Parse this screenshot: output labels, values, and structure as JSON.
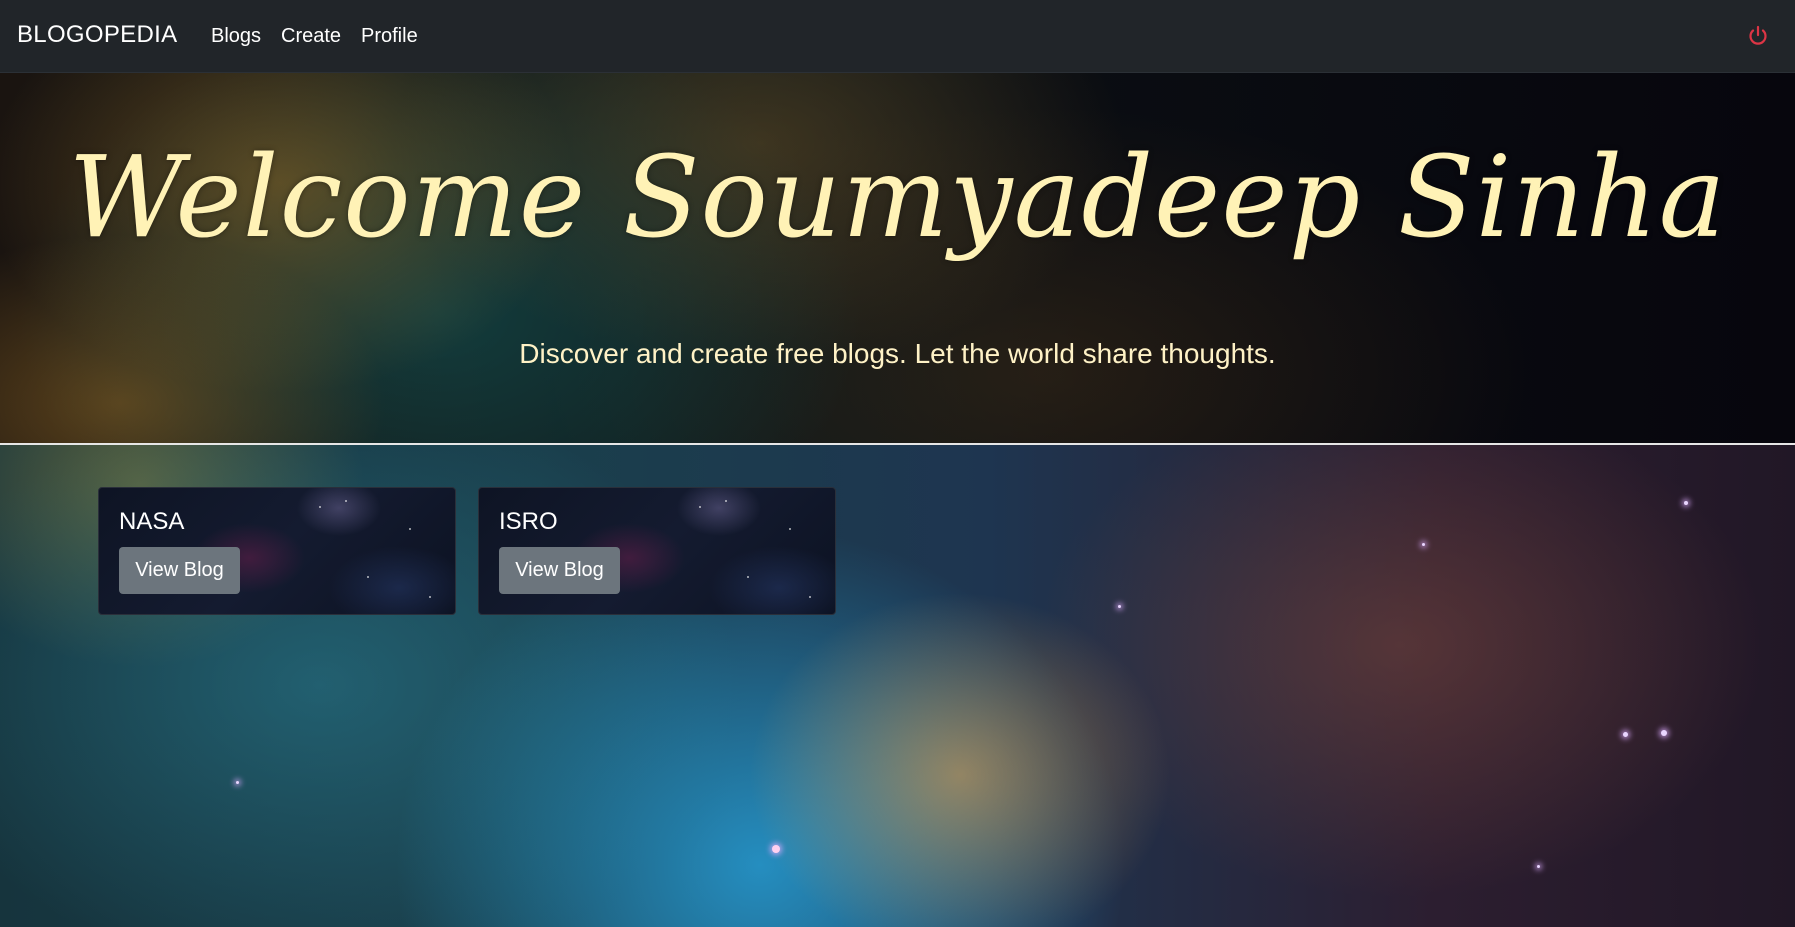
{
  "navbar": {
    "brand": "BLOGOPEDIA",
    "links": [
      "Blogs",
      "Create",
      "Profile"
    ],
    "logout_icon": "power-icon",
    "logout_color": "#dc3545"
  },
  "hero": {
    "title": "Welcome Soumyadeep Sinha",
    "subtitle": "Discover and create free blogs. Let the world share thoughts."
  },
  "blogs": [
    {
      "name": "NASA",
      "button": "View Blog"
    },
    {
      "name": "ISRO",
      "button": "View Blog"
    }
  ]
}
